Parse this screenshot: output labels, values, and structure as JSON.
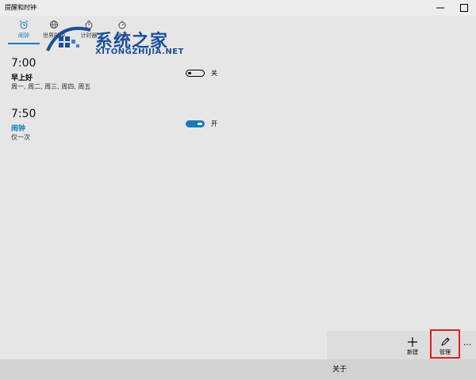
{
  "window": {
    "title": "提醒和时钟"
  },
  "tabs": [
    {
      "label": "闹钟",
      "icon": "alarm-clock-icon",
      "active": true
    },
    {
      "label": "世界时钟",
      "icon": "globe-icon",
      "active": false
    },
    {
      "label": "计时器",
      "icon": "timer-icon",
      "active": false
    },
    {
      "label": "秒表",
      "icon": "stopwatch-icon",
      "active": false
    }
  ],
  "watermark": {
    "title": "系统之家",
    "subtitle": "XITONGZHIJIA.NET"
  },
  "alarms": [
    {
      "time": "7:00",
      "name": "早上好",
      "repeat": "周一, 周二, 周三, 周四, 周五",
      "state_label": "关",
      "enabled": false
    },
    {
      "time": "7:50",
      "name": "闹钟",
      "repeat": "仅一次",
      "state_label": "开",
      "enabled": true
    }
  ],
  "commandbar": {
    "new_label": "新建",
    "manage_label": "管理",
    "more_label": "...",
    "about_label": "关于"
  },
  "colors": {
    "accent": "#0f7fbf",
    "highlight": "#e02020",
    "toggle_on": "#1b7ab8"
  }
}
